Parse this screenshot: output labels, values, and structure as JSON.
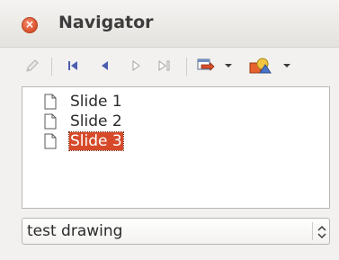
{
  "window": {
    "title": "Navigator"
  },
  "toolbar": {
    "icons": [
      "pen-icon",
      "first-slide-icon",
      "previous-slide-icon",
      "next-slide-icon",
      "last-slide-icon",
      "drag-mode-icon",
      "drag-mode-dropdown-icon",
      "shapes-icon",
      "shapes-dropdown-icon"
    ]
  },
  "tree": {
    "items": [
      {
        "label": "Slide 1",
        "selected": false
      },
      {
        "label": "Slide 2",
        "selected": false
      },
      {
        "label": "Slide 3",
        "selected": true
      }
    ]
  },
  "document_select": {
    "value": "test drawing"
  },
  "colors": {
    "close_button": "#d9502c",
    "selection": "#d64a2a"
  }
}
